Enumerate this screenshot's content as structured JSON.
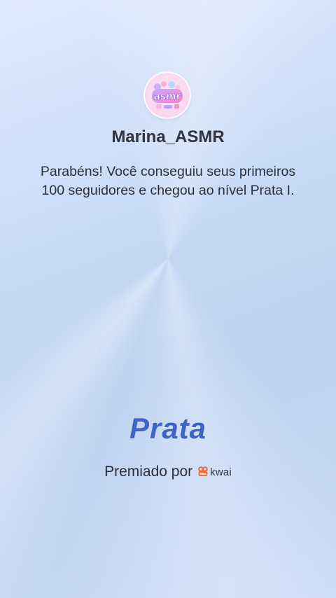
{
  "profile": {
    "username": "Marina_ASMR",
    "avatar_text": "asmr"
  },
  "message": {
    "text": "Parabéns! Você conseguiu seus primeiros 100 seguidores e chegou ao nível Prata I."
  },
  "level": {
    "name": "Prata"
  },
  "award": {
    "prefix": "Premiado por",
    "brand": "kwai",
    "brand_icon": "kwai-logo-icon"
  },
  "colors": {
    "level_text": "#3f64c4",
    "brand_orange": "#ff5a1f",
    "text_dark": "#2b2f38"
  }
}
